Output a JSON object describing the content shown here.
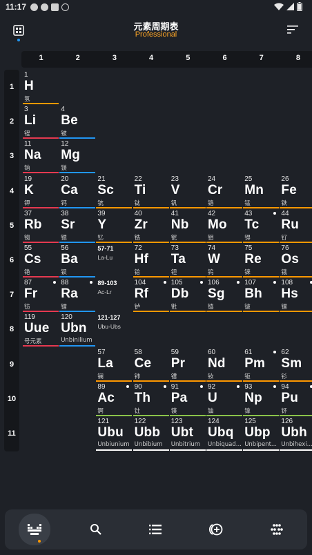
{
  "status_bar": {
    "time": "11:17"
  },
  "header": {
    "title": "元素周期表",
    "subtitle": "Professional"
  },
  "groups": [
    "1",
    "2",
    "3",
    "4",
    "5",
    "6",
    "7",
    "8"
  ],
  "periods": [
    "1",
    "2",
    "3",
    "4",
    "5",
    "6",
    "7",
    "8",
    "9",
    "10",
    "11"
  ],
  "colors": {
    "nonmetal": "#ff9800",
    "alkali": "#e53950",
    "alkaline": "#2196f3",
    "transition": "#ff9800",
    "lanthanide": "#ff9800",
    "actinide": "#8bc34a",
    "unknown": "#ffffff"
  },
  "elements": [
    {
      "num": "1",
      "sym": "H",
      "name": "氢",
      "col": 0,
      "row": 0,
      "cat": "nonmetal"
    },
    {
      "num": "3",
      "sym": "Li",
      "name": "锂",
      "col": 0,
      "row": 1,
      "cat": "alkali"
    },
    {
      "num": "4",
      "sym": "Be",
      "name": "铍",
      "col": 1,
      "row": 1,
      "cat": "alkaline"
    },
    {
      "num": "11",
      "sym": "Na",
      "name": "钠",
      "col": 0,
      "row": 2,
      "cat": "alkali"
    },
    {
      "num": "12",
      "sym": "Mg",
      "name": "镁",
      "col": 1,
      "row": 2,
      "cat": "alkaline"
    },
    {
      "num": "19",
      "sym": "K",
      "name": "钾",
      "col": 0,
      "row": 3,
      "cat": "alkali"
    },
    {
      "num": "20",
      "sym": "Ca",
      "name": "钙",
      "col": 1,
      "row": 3,
      "cat": "alkaline"
    },
    {
      "num": "21",
      "sym": "Sc",
      "name": "钪",
      "col": 2,
      "row": 3,
      "cat": "transition"
    },
    {
      "num": "22",
      "sym": "Ti",
      "name": "钛",
      "col": 3,
      "row": 3,
      "cat": "transition"
    },
    {
      "num": "23",
      "sym": "V",
      "name": "钒",
      "col": 4,
      "row": 3,
      "cat": "transition"
    },
    {
      "num": "24",
      "sym": "Cr",
      "name": "铬",
      "col": 5,
      "row": 3,
      "cat": "transition"
    },
    {
      "num": "25",
      "sym": "Mn",
      "name": "锰",
      "col": 6,
      "row": 3,
      "cat": "transition"
    },
    {
      "num": "26",
      "sym": "Fe",
      "name": "铁",
      "col": 7,
      "row": 3,
      "cat": "transition"
    },
    {
      "num": "37",
      "sym": "Rb",
      "name": "铷",
      "col": 0,
      "row": 4,
      "cat": "alkali"
    },
    {
      "num": "38",
      "sym": "Sr",
      "name": "锶",
      "col": 1,
      "row": 4,
      "cat": "alkaline"
    },
    {
      "num": "39",
      "sym": "Y",
      "name": "钇",
      "col": 2,
      "row": 4,
      "cat": "transition"
    },
    {
      "num": "40",
      "sym": "Zr",
      "name": "锆",
      "col": 3,
      "row": 4,
      "cat": "transition"
    },
    {
      "num": "41",
      "sym": "Nb",
      "name": "铌",
      "col": 4,
      "row": 4,
      "cat": "transition"
    },
    {
      "num": "42",
      "sym": "Mo",
      "name": "钼",
      "col": 5,
      "row": 4,
      "cat": "transition"
    },
    {
      "num": "43",
      "sym": "Tc",
      "name": "锝",
      "col": 6,
      "row": 4,
      "cat": "transition",
      "radio": true
    },
    {
      "num": "44",
      "sym": "Ru",
      "name": "钌",
      "col": 7,
      "row": 4,
      "cat": "transition"
    },
    {
      "num": "55",
      "sym": "Cs",
      "name": "铯",
      "col": 0,
      "row": 5,
      "cat": "alkali"
    },
    {
      "num": "56",
      "sym": "Ba",
      "name": "钡",
      "col": 1,
      "row": 5,
      "cat": "alkaline"
    },
    {
      "num": "72",
      "sym": "Hf",
      "name": "铪",
      "col": 3,
      "row": 5,
      "cat": "transition"
    },
    {
      "num": "73",
      "sym": "Ta",
      "name": "钽",
      "col": 4,
      "row": 5,
      "cat": "transition"
    },
    {
      "num": "74",
      "sym": "W",
      "name": "钨",
      "col": 5,
      "row": 5,
      "cat": "transition"
    },
    {
      "num": "75",
      "sym": "Re",
      "name": "铼",
      "col": 6,
      "row": 5,
      "cat": "transition"
    },
    {
      "num": "76",
      "sym": "Os",
      "name": "锇",
      "col": 7,
      "row": 5,
      "cat": "transition"
    },
    {
      "num": "87",
      "sym": "Fr",
      "name": "钫",
      "col": 0,
      "row": 6,
      "cat": "alkali",
      "radio": true
    },
    {
      "num": "88",
      "sym": "Ra",
      "name": "镭",
      "col": 1,
      "row": 6,
      "cat": "alkaline",
      "radio": true
    },
    {
      "num": "104",
      "sym": "Rf",
      "name": "𬬻",
      "col": 3,
      "row": 6,
      "cat": "transition",
      "radio": true
    },
    {
      "num": "105",
      "sym": "Db",
      "name": "𬭊",
      "col": 4,
      "row": 6,
      "cat": "transition",
      "radio": true
    },
    {
      "num": "106",
      "sym": "Sg",
      "name": "𬭳",
      "col": 5,
      "row": 6,
      "cat": "transition",
      "radio": true
    },
    {
      "num": "107",
      "sym": "Bh",
      "name": "𬭛",
      "col": 6,
      "row": 6,
      "cat": "transition",
      "radio": true
    },
    {
      "num": "108",
      "sym": "Hs",
      "name": "𬭶",
      "col": 7,
      "row": 6,
      "cat": "transition",
      "radio": true
    },
    {
      "num": "119",
      "sym": "Uue",
      "name": "号元素",
      "col": 0,
      "row": 7,
      "cat": "alkali"
    },
    {
      "num": "120",
      "sym": "Ubn",
      "name": "Unbinilium",
      "col": 1,
      "row": 7,
      "cat": "alkaline"
    },
    {
      "num": "57",
      "sym": "La",
      "name": "镧",
      "col": 2,
      "row": 8,
      "cat": "lanthanide"
    },
    {
      "num": "58",
      "sym": "Ce",
      "name": "铈",
      "col": 3,
      "row": 8,
      "cat": "lanthanide"
    },
    {
      "num": "59",
      "sym": "Pr",
      "name": "镨",
      "col": 4,
      "row": 8,
      "cat": "lanthanide"
    },
    {
      "num": "60",
      "sym": "Nd",
      "name": "钕",
      "col": 5,
      "row": 8,
      "cat": "lanthanide"
    },
    {
      "num": "61",
      "sym": "Pm",
      "name": "钷",
      "col": 6,
      "row": 8,
      "cat": "lanthanide",
      "radio": true
    },
    {
      "num": "62",
      "sym": "Sm",
      "name": "钐",
      "col": 7,
      "row": 8,
      "cat": "lanthanide"
    },
    {
      "num": "89",
      "sym": "Ac",
      "name": "锕",
      "col": 2,
      "row": 9,
      "cat": "actinide",
      "radio": true
    },
    {
      "num": "90",
      "sym": "Th",
      "name": "钍",
      "col": 3,
      "row": 9,
      "cat": "actinide",
      "radio": true
    },
    {
      "num": "91",
      "sym": "Pa",
      "name": "镤",
      "col": 4,
      "row": 9,
      "cat": "actinide",
      "radio": true
    },
    {
      "num": "92",
      "sym": "U",
      "name": "铀",
      "col": 5,
      "row": 9,
      "cat": "actinide",
      "radio": true
    },
    {
      "num": "93",
      "sym": "Np",
      "name": "镎",
      "col": 6,
      "row": 9,
      "cat": "actinide",
      "radio": true
    },
    {
      "num": "94",
      "sym": "Pu",
      "name": "钚",
      "col": 7,
      "row": 9,
      "cat": "actinide",
      "radio": true
    },
    {
      "num": "121",
      "sym": "Ubu",
      "name": "Unbiunium",
      "col": 2,
      "row": 10,
      "cat": "unknown"
    },
    {
      "num": "122",
      "sym": "Ubb",
      "name": "Unbibium",
      "col": 3,
      "row": 10,
      "cat": "unknown"
    },
    {
      "num": "123",
      "sym": "Ubt",
      "name": "Unbitrium",
      "col": 4,
      "row": 10,
      "cat": "unknown"
    },
    {
      "num": "124",
      "sym": "Ubq",
      "name": "Unbiquad...",
      "col": 5,
      "row": 10,
      "cat": "unknown"
    },
    {
      "num": "125",
      "sym": "Ubp",
      "name": "Unbipent...",
      "col": 6,
      "row": 10,
      "cat": "unknown"
    },
    {
      "num": "126",
      "sym": "Ubh",
      "name": "Unbihexi...",
      "col": 7,
      "row": 10,
      "cat": "unknown"
    }
  ],
  "placeholders": [
    {
      "num": "57-71",
      "range": "La-Lu",
      "col": 2,
      "row": 5
    },
    {
      "num": "89-103",
      "range": "Ac-Lr",
      "col": 2,
      "row": 6
    },
    {
      "num": "121-127",
      "range": "Ubu-Ubs",
      "col": 2,
      "row": 7
    }
  ],
  "bottom_nav": [
    {
      "name": "nav-table",
      "icon": "grid-chart-icon",
      "active": true
    },
    {
      "name": "nav-search",
      "icon": "search-icon"
    },
    {
      "name": "nav-list",
      "icon": "list-icon"
    },
    {
      "name": "nav-add-compare",
      "icon": "add-circle-icon"
    },
    {
      "name": "nav-more",
      "icon": "dots-grid-icon"
    }
  ]
}
